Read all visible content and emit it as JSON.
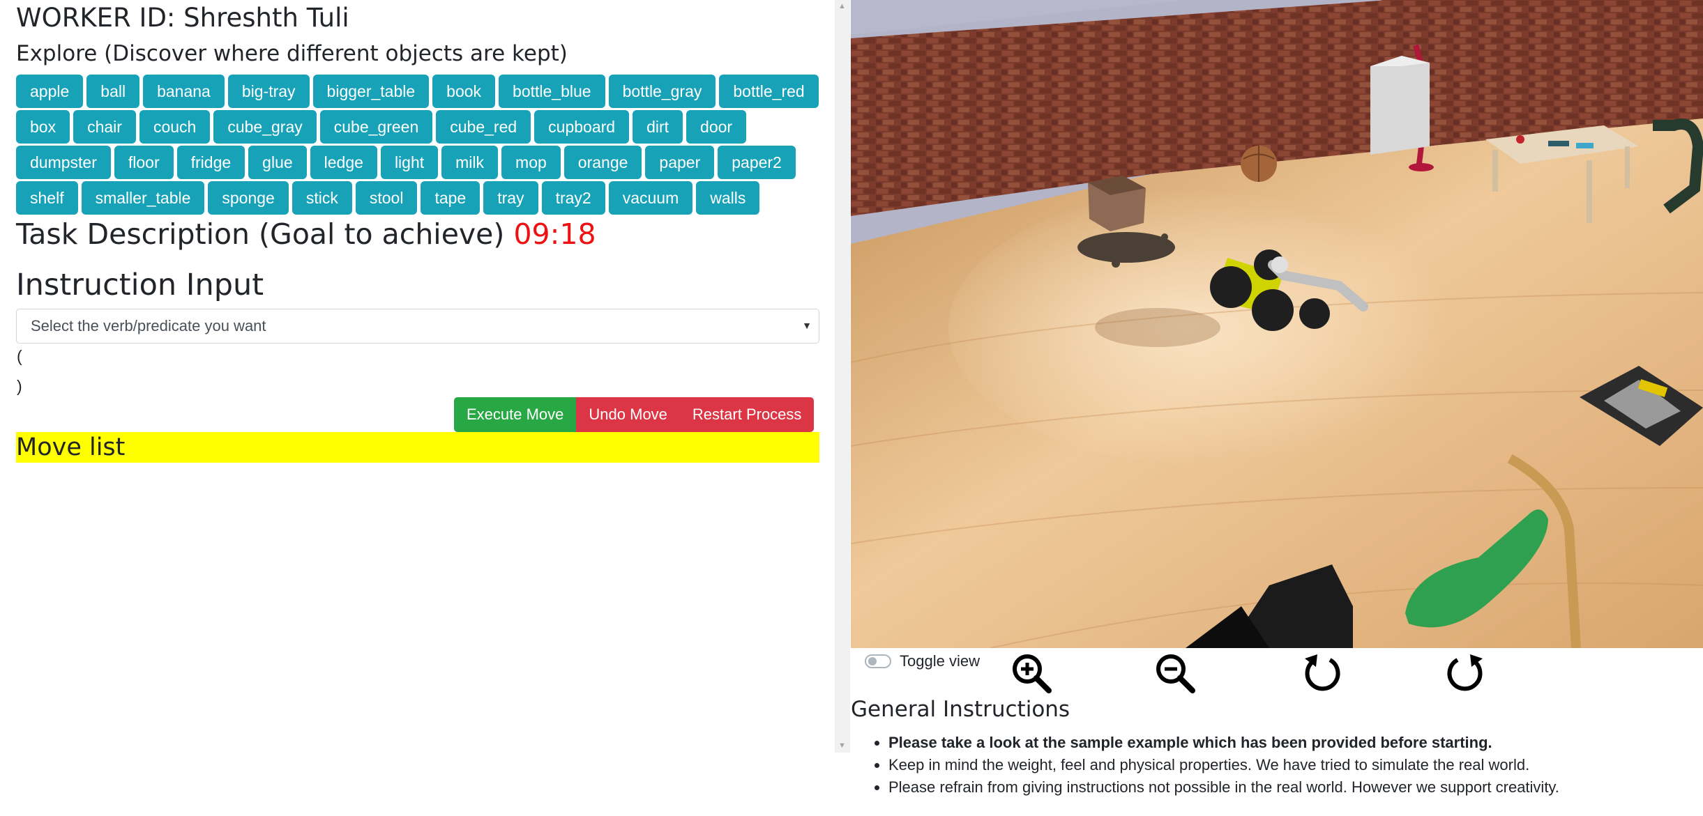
{
  "header": {
    "worker_title": "WORKER ID: Shreshth Tuli",
    "explore_title": "Explore (Discover where different objects are kept)"
  },
  "objects": [
    "apple",
    "ball",
    "banana",
    "big-tray",
    "bigger_table",
    "book",
    "bottle_blue",
    "bottle_gray",
    "bottle_red",
    "box",
    "chair",
    "couch",
    "cube_gray",
    "cube_green",
    "cube_red",
    "cupboard",
    "dirt",
    "door",
    "dumpster",
    "floor",
    "fridge",
    "glue",
    "ledge",
    "light",
    "milk",
    "mop",
    "orange",
    "paper",
    "paper2",
    "shelf",
    "smaller_table",
    "sponge",
    "stick",
    "stool",
    "tape",
    "tray",
    "tray2",
    "vacuum",
    "walls"
  ],
  "task": {
    "title": "Task Description (Goal to achieve)",
    "timer": "09:18"
  },
  "instruction": {
    "title": "Instruction Input",
    "select_value": "Select the verb/predicate you want",
    "open_paren": "(",
    "close_paren": ")"
  },
  "actions": {
    "execute": "Execute Move",
    "undo": "Undo Move",
    "restart": "Restart Process"
  },
  "move_list": {
    "title": "Move list"
  },
  "viewer": {
    "toggle_label": "Toggle view",
    "icons": [
      "zoom-in-icon",
      "zoom-out-icon",
      "rotate-left-icon",
      "rotate-right-icon"
    ]
  },
  "general": {
    "title": "General Instructions",
    "items": [
      "Please take a look at the sample example which has been provided before starting.",
      "Keep in mind the weight, feel and physical properties. We have tried to simulate the real world.",
      "Please refrain from giving instructions not possible in the real world. However we support creativity."
    ]
  },
  "colors": {
    "object_button": "#17a2b8",
    "execute": "#28a745",
    "danger": "#dc3545",
    "timer": "#ee1111",
    "move_list_bg": "#ffff00"
  }
}
